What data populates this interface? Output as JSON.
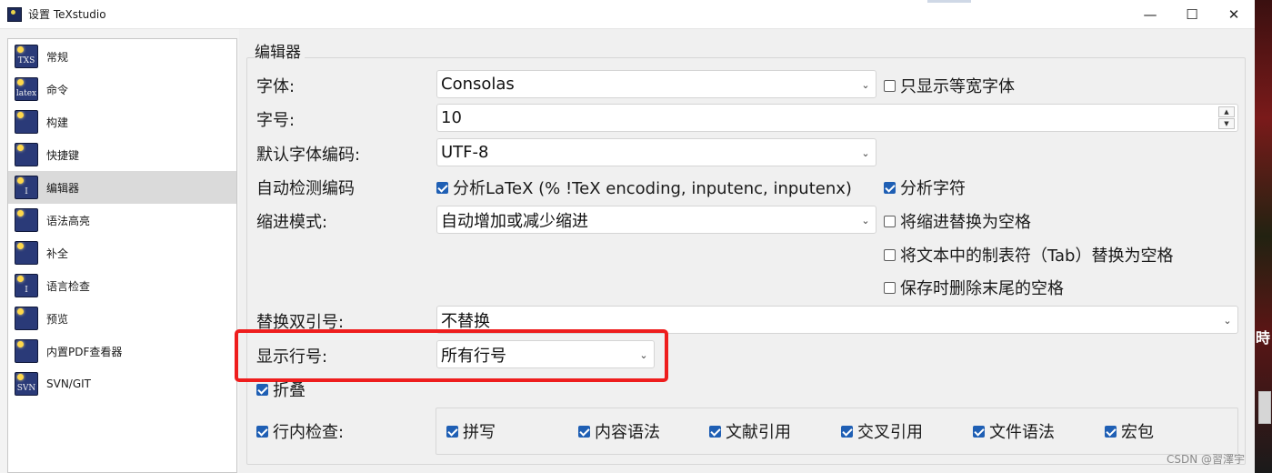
{
  "window": {
    "title": "设置 TeXstudio",
    "minimize_glyph": "—",
    "maximize_glyph": "☐",
    "close_glyph": "✕"
  },
  "sidebar": {
    "items": [
      {
        "label": "常规",
        "icon": "txs-icon",
        "icon_text": "TXS"
      },
      {
        "label": "命令",
        "icon": "latex-command-icon",
        "icon_text": "latex"
      },
      {
        "label": "构建",
        "icon": "build-icon",
        "icon_text": ""
      },
      {
        "label": "快捷键",
        "icon": "keyboard-icon",
        "icon_text": ""
      },
      {
        "label": "编辑器",
        "icon": "editor-icon",
        "icon_text": "I"
      },
      {
        "label": "语法高亮",
        "icon": "syntax-highlight-icon",
        "icon_text": ""
      },
      {
        "label": "补全",
        "icon": "completion-icon",
        "icon_text": ""
      },
      {
        "label": "语言检查",
        "icon": "language-check-icon",
        "icon_text": "I"
      },
      {
        "label": "预览",
        "icon": "preview-icon",
        "icon_text": ""
      },
      {
        "label": "内置PDF查看器",
        "icon": "pdf-viewer-icon",
        "icon_text": ""
      },
      {
        "label": "SVN/GIT",
        "icon": "svn-icon",
        "icon_text": "SVN"
      }
    ],
    "active_index": 4
  },
  "editor": {
    "group_title": "编辑器",
    "font_label": "字体:",
    "font_value": "Consolas",
    "monospace_only_label": "只显示等宽字体",
    "font_size_label": "字号:",
    "font_size_value": "10",
    "default_encoding_label": "默认字体编码:",
    "default_encoding_value": "UTF-8",
    "auto_detect_label": "自动检测编码",
    "analyze_latex_label": "分析LaTeX (% !TeX encoding, inputenc, inputenx)",
    "analyze_chars_label": "分析字符",
    "indent_mode_label": "缩进模式:",
    "indent_mode_value": "自动增加或减少缩进",
    "indent_to_spaces_label": "将缩进替换为空格",
    "tabs_to_spaces_label": "将文本中的制表符（Tab）替换为空格",
    "remove_trailing_label": "保存时删除末尾的空格",
    "replace_quotes_label": "替换双引号:",
    "replace_quotes_value": "不替换",
    "line_numbers_label": "显示行号:",
    "line_numbers_value": "所有行号",
    "folding_label": "折叠",
    "inline_check_label": "行内检查:",
    "inline_items": [
      "拼写",
      "内容语法",
      "文献引用",
      "交叉引用",
      "文件语法",
      "宏包"
    ]
  },
  "watermark": "CSDN @習澤宇",
  "colors": {
    "highlight": "#ee1d1d",
    "checkbox_on": "#1f5fb4",
    "active_row": "#dadada"
  }
}
